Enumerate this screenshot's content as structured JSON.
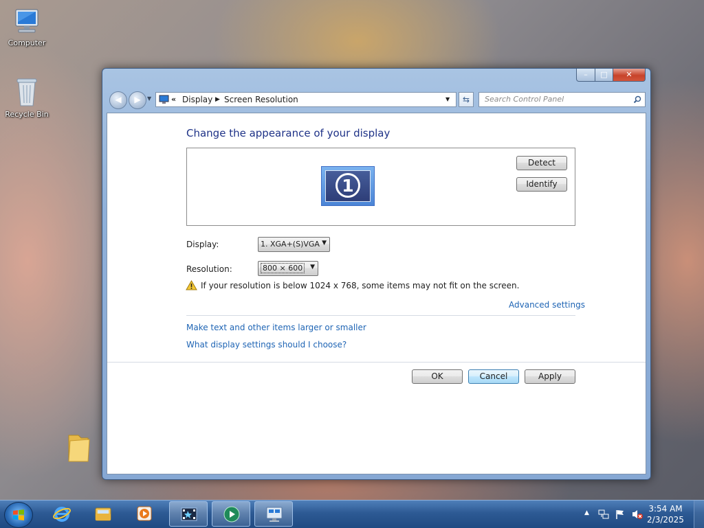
{
  "desktop": {
    "icons": [
      {
        "name": "computer",
        "label": "Computer"
      },
      {
        "name": "recycle-bin",
        "label": "Recycle Bin"
      }
    ]
  },
  "window": {
    "breadcrumb": [
      "Display",
      "Screen Resolution"
    ],
    "breadcrumb_prefix": "«",
    "search_placeholder": "Search Control Panel",
    "heading": "Change the appearance of your display",
    "monitor_number": "1",
    "detect_label": "Detect",
    "identify_label": "Identify",
    "display_label": "Display:",
    "display_value": "1. XGA+(S)VGA",
    "resolution_label": "Resolution:",
    "resolution_value": "800 × 600",
    "warning_text": "If your resolution is below 1024 x 768, some items may not fit on the screen.",
    "advanced_link": "Advanced settings",
    "links": [
      "Make text and other items larger or smaller",
      "What display settings should I choose?"
    ],
    "ok_label": "OK",
    "cancel_label": "Cancel",
    "apply_label": "Apply",
    "title_buttons": {
      "minimize": "–",
      "maximize": "□",
      "close": "✕"
    }
  },
  "taskbar": {
    "time": "3:54 AM",
    "date": "2/3/2025",
    "items": [
      "internet-explorer",
      "windows-explorer",
      "media-player",
      "movie-maker",
      "media-center",
      "display-settings"
    ]
  },
  "colors": {
    "link": "#1e64b4",
    "heading": "#1e3287",
    "taskbar": "#2d5a94"
  }
}
